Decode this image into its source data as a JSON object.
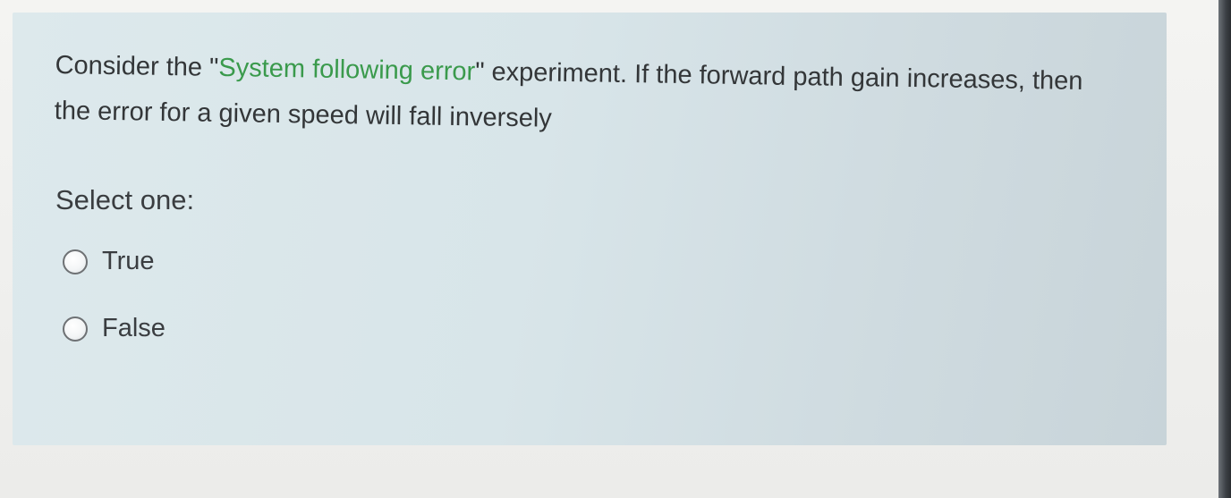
{
  "question": {
    "text_before": "Consider the \"",
    "highlight": "System following error",
    "text_after": "\" experiment. If the forward path gain increases, then the error for a given speed will fall inversely",
    "highlight_color": "#3a9a4c"
  },
  "prompt": "Select one:",
  "options": [
    {
      "label": "True",
      "selected": false
    },
    {
      "label": "False",
      "selected": false
    }
  ],
  "icons": {
    "radio": "radio-unselected-icon"
  }
}
